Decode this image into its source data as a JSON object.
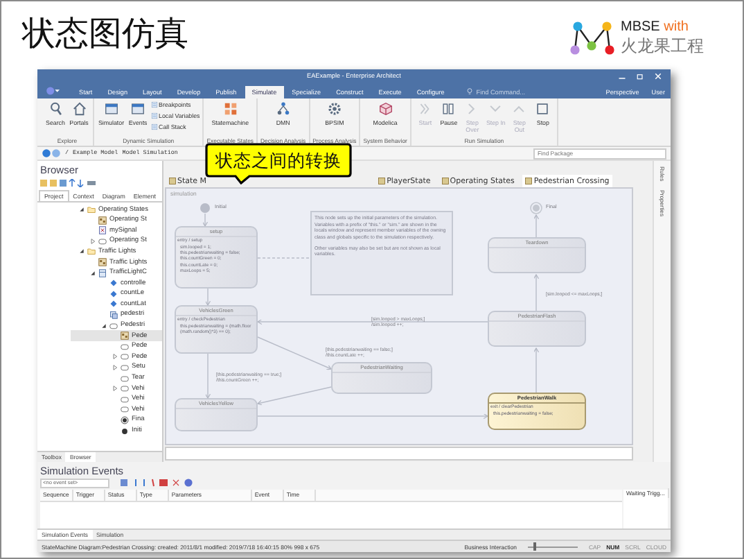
{
  "slide": {
    "title": "状态图仿真",
    "logo": {
      "brand": "MBSE",
      "accent": "with",
      "subtitle": "火龙果工程"
    }
  },
  "window": {
    "title": "EAExample - Enterprise Architect"
  },
  "ribbon_tabs": [
    {
      "label": "Start",
      "selected": false
    },
    {
      "label": "Design",
      "selected": false
    },
    {
      "label": "Layout",
      "selected": false
    },
    {
      "label": "Develop",
      "selected": false
    },
    {
      "label": "Publish",
      "selected": false
    },
    {
      "label": "Simulate",
      "selected": true
    },
    {
      "label": "Specialize",
      "selected": false
    },
    {
      "label": "Construct",
      "selected": false
    },
    {
      "label": "Execute",
      "selected": false
    },
    {
      "label": "Configure",
      "selected": false
    }
  ],
  "find_command": {
    "placeholder": "Find Command..."
  },
  "perspective": "Perspective",
  "user": "User",
  "ribbon_groups": [
    {
      "label": "Explore",
      "buttons": [
        {
          "label": "Search",
          "kind": "large",
          "disabled": false
        },
        {
          "label": "Portals",
          "kind": "large",
          "disabled": false
        }
      ]
    },
    {
      "label": "Dynamic Simulation",
      "buttons": [
        {
          "label": "Simulator",
          "kind": "large",
          "disabled": false
        },
        {
          "label": "Events",
          "kind": "large",
          "disabled": false
        },
        {
          "label": "Breakpoints",
          "kind": "small",
          "disabled": false
        },
        {
          "label": "Local Variables",
          "kind": "small",
          "disabled": false
        },
        {
          "label": "Call Stack",
          "kind": "small",
          "disabled": false
        }
      ]
    },
    {
      "label": "Executable States",
      "buttons": [
        {
          "label": "Statemachine",
          "kind": "large",
          "disabled": false
        }
      ]
    },
    {
      "label": "Decision Analysis",
      "buttons": [
        {
          "label": "DMN",
          "kind": "large",
          "disabled": false
        }
      ]
    },
    {
      "label": "Process Analysis",
      "buttons": [
        {
          "label": "BPSIM",
          "kind": "large",
          "disabled": false
        }
      ]
    },
    {
      "label": "System Behavior",
      "buttons": [
        {
          "label": "Modelica",
          "kind": "large",
          "disabled": false
        }
      ]
    },
    {
      "label": "Run Simulation",
      "buttons": [
        {
          "label": "Start",
          "kind": "large",
          "disabled": true
        },
        {
          "label": "Pause",
          "kind": "large",
          "disabled": false
        },
        {
          "label": "Step Over",
          "kind": "large",
          "disabled": true
        },
        {
          "label": "Step In",
          "kind": "large",
          "disabled": true
        },
        {
          "label": "Step Out",
          "kind": "large",
          "disabled": true
        },
        {
          "label": "Stop",
          "kind": "large",
          "disabled": false
        }
      ]
    }
  ],
  "path_bar": {
    "crumbs": [
      "/",
      "Example Model",
      "Model Simulation"
    ],
    "find_package": {
      "placeholder": "Find Package"
    }
  },
  "browser": {
    "title": "Browser",
    "tabs": [
      {
        "label": "Project",
        "selected": true
      },
      {
        "label": "Context",
        "selected": false
      },
      {
        "label": "Diagram",
        "selected": false
      },
      {
        "label": "Element",
        "selected": false
      }
    ],
    "tree": [
      {
        "label": "Operating States",
        "kind": "folder",
        "selected": false,
        "expanded": true,
        "children": [
          {
            "label": "Operating St",
            "kind": "diagram",
            "selected": false
          },
          {
            "label": "mySignal",
            "kind": "signal",
            "selected": false
          },
          {
            "label": "Operating St",
            "kind": "state",
            "selected": false,
            "expanded": false
          }
        ]
      },
      {
        "label": "Traffic Lights",
        "kind": "folder",
        "selected": false,
        "expanded": true,
        "children": [
          {
            "label": "Traffic Lights",
            "kind": "diagram",
            "selected": false
          },
          {
            "label": "TrafficLightC",
            "kind": "class",
            "selected": false,
            "expanded": true,
            "children": [
              {
                "label": "controlle",
                "kind": "attribute",
                "selected": false
              },
              {
                "label": "countLe",
                "kind": "attribute",
                "selected": false
              },
              {
                "label": "countLat",
                "kind": "attribute",
                "selected": false
              },
              {
                "label": "pedestri",
                "kind": "part",
                "selected": false
              },
              {
                "label": "Pedestri",
                "kind": "state",
                "selected": false,
                "expanded": true,
                "children": [
                  {
                    "label": "Pede",
                    "kind": "diagram",
                    "selected": true
                  },
                  {
                    "label": "Pede",
                    "kind": "state",
                    "selected": false
                  },
                  {
                    "label": "Pede",
                    "kind": "state",
                    "selected": false,
                    "expanded": false
                  },
                  {
                    "label": "Setu",
                    "kind": "state",
                    "selected": false,
                    "expanded": false
                  },
                  {
                    "label": "Tear",
                    "kind": "state",
                    "selected": false
                  },
                  {
                    "label": "Vehi",
                    "kind": "state",
                    "selected": false,
                    "expanded": false
                  },
                  {
                    "label": "Vehi",
                    "kind": "state",
                    "selected": false
                  },
                  {
                    "label": "Vehi",
                    "kind": "state",
                    "selected": false
                  },
                  {
                    "label": "Fina",
                    "kind": "final",
                    "selected": false
                  },
                  {
                    "label": "Initi",
                    "kind": "initial",
                    "selected": false
                  }
                ]
              }
            ]
          }
        ]
      }
    ],
    "bottom_tabs": [
      {
        "label": "Toolbox",
        "selected": false
      },
      {
        "label": "Browser",
        "selected": true
      }
    ]
  },
  "callout": "状态之间的转换",
  "diagram_tabs": [
    {
      "label": "State M",
      "selected": false
    },
    {
      "label": "PlayerState",
      "selected": false
    },
    {
      "label": "Operating States",
      "selected": false
    },
    {
      "label": "Pedestrian Crossing",
      "selected": true
    }
  ],
  "diagram": {
    "frame_label": "simulation",
    "initial_label": "Initial",
    "final_label": "Final",
    "states": [
      {
        "name": "setup",
        "highlighted": false,
        "lines": [
          "entry / setup",
          "sim.looped = 1;",
          "this.pedestrianwaiting = false;",
          "this.countGreen = 0;",
          "this.countLate = 0;",
          "maxLoops = 5;"
        ]
      },
      {
        "name": "VehiclesGreen",
        "highlighted": false,
        "lines": [
          "entry / checkPedestrian",
          "this.pedestrianwaiting = (math.floor",
          "(math.random()*3) == 0);"
        ]
      },
      {
        "name": "VehiclesYellow",
        "highlighted": false
      },
      {
        "name": "Teardown",
        "highlighted": false
      },
      {
        "name": "PedestrianFlash",
        "highlighted": false
      },
      {
        "name": "PedestrianWaiting",
        "highlighted": false
      },
      {
        "name": "PedestrianWalk",
        "highlighted": true,
        "lines": [
          "exit / clearPedestrian",
          "this.pedestrianwaiting = false;"
        ]
      }
    ],
    "note": [
      "This node sets up the initial parameters of the simulation. Variables with a prefix of \"this.\" or \"sim.\" are shown in the locals window and represent member variables of the owning class and globals specific to the simulation respectively.",
      "Other variables may also be set but are not shown as local variables."
    ],
    "guards": [
      [
        "[sim.looped <= maxLoops;]"
      ],
      [
        "[sim.looped > maxLoops;]",
        "/sim.looped ++;"
      ],
      [
        "[this.pedestrianwaiting == false;]",
        "/this.countLate ++;"
      ],
      [
        "[this.pedestrianwaiting == true;]",
        "/this.countGreen ++;"
      ]
    ]
  },
  "side_panels": [
    "Rules",
    "Properties"
  ],
  "simulation_events": {
    "title": "Simulation Events",
    "event_set": "<no event set>",
    "columns": [
      "Sequence",
      "Trigger",
      "Status",
      "Type",
      "Parameters",
      "Event",
      "Time"
    ],
    "side_column": "Waiting Trigg...",
    "tabs": [
      {
        "label": "Simulation Events",
        "selected": true
      },
      {
        "label": "Simulation",
        "selected": false
      }
    ]
  },
  "status_bar": {
    "text": "StateMachine Diagram:Pedestrian Crossing:  created: 2011/8/1  modified: 2019/7/18 16:40:15  80%  998 x 675",
    "perspective": "Business Interaction",
    "zoom": {
      "level": 0.1
    },
    "indicators": [
      {
        "label": "CAP",
        "on": false
      },
      {
        "label": "NUM",
        "on": true
      },
      {
        "label": "SCRL",
        "on": false
      },
      {
        "label": "CLOUD",
        "on": false
      }
    ]
  }
}
